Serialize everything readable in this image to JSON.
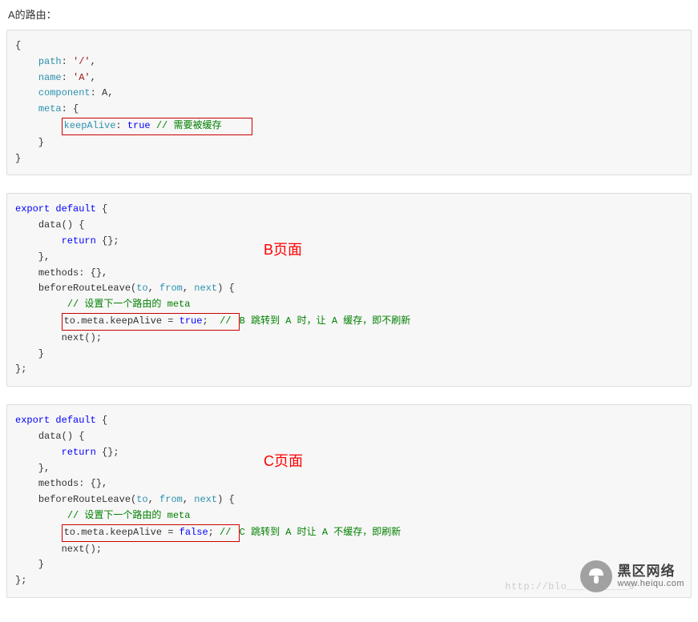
{
  "heading": "A的路由：",
  "block1": {
    "path_key": "path",
    "path_val": "'/'",
    "name_key": "name",
    "name_val": "'A'",
    "component_key": "component",
    "component_val": "A",
    "meta_key": "meta",
    "keepalive_key": "keepAlive",
    "keepalive_val": "true",
    "comment": "// 需要被缓存"
  },
  "block2": {
    "label": "B页面",
    "export": "export",
    "default": "default",
    "data": "data",
    "return": "return",
    "methods": "methods",
    "before": "beforeRouteLeave",
    "p_to": "to",
    "p_from": "from",
    "p_next": "next",
    "cm1": "// 设置下一个路由的 meta",
    "assign_lhs": "to.meta.keepAlive = ",
    "assign_val": "true",
    "assign_semi": ";",
    "cm2_pre": "// ",
    "cm2_rest": "B 跳转到 A 时，让 A 缓存，即不刷新",
    "next_call": "next();"
  },
  "block3": {
    "label": "C页面",
    "export": "export",
    "default": "default",
    "data": "data",
    "return": "return",
    "methods": "methods",
    "before": "beforeRouteLeave",
    "p_to": "to",
    "p_from": "from",
    "p_next": "next",
    "cm1": "// 设置下一个路由的 meta",
    "assign_lhs": "to.meta.keepAlive = ",
    "assign_val": "false",
    "assign_semi": ";",
    "cm2_pre": " // ",
    "cm2_letter": "C",
    "cm2_rest": " 跳转到 A 时让 A 不缓存，即刷新",
    "next_call": "next();"
  },
  "watermark": {
    "line1": "黑区网络",
    "line2": "www.heiqu.com",
    "faint_url": "http://blo___sdn____9"
  }
}
